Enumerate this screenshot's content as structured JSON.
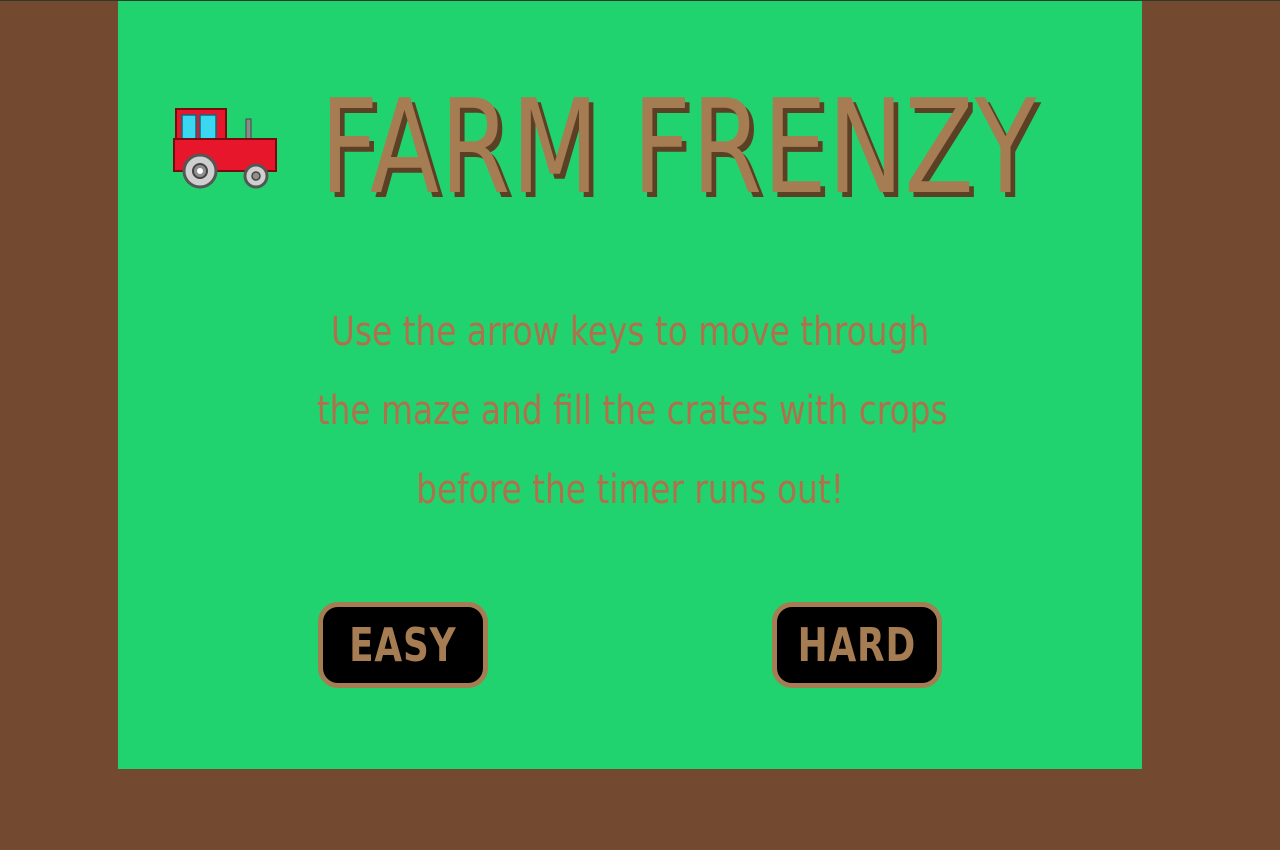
{
  "game": {
    "title": "FARM FRENZY",
    "instructions": [
      "Use the arrow keys to move through",
      "the maze and fill the crates with crops",
      "before the timer runs out!"
    ],
    "buttons": {
      "easy_label": "EASY",
      "hard_label": "HARD"
    },
    "icon": "tractor-icon"
  },
  "colors": {
    "background": "#734a30",
    "panel": "#21d36f",
    "title": "#a67c52",
    "instructions": "#b0704c",
    "button_bg": "#000000",
    "button_border": "#a67c52"
  }
}
